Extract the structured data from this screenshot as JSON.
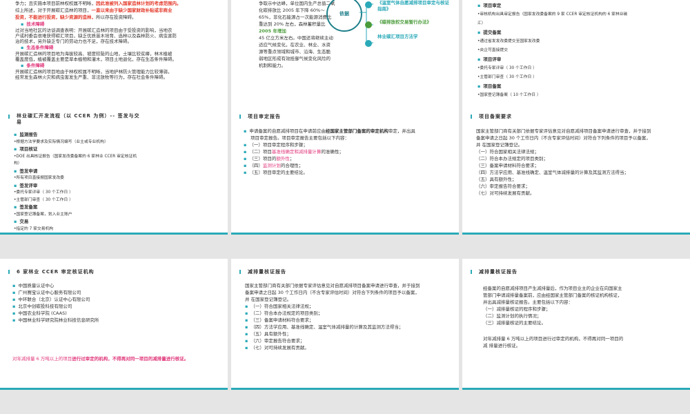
{
  "s1": {
    "lines": [
      "争力；且实施本项目前林权权属不明晰，",
      "因此准被列入国家造林计划的考虑范围内。",
      "综上所述，对于开展碳汇造林的项目，",
      "一直以来由于缺少国家财政补贴或非商业",
      "投资，不能进行投资，",
      "缺少资源的造林，",
      "所以存在投资障碍。",
      "技术障碍",
      "过对当地社区的访谈调查表明：开展碳汇造林的项目由于受投资的影响，当地农",
      "户或村委会很难获得碳汇项目，缺乏优质苗木培育、选林以及森林防火、病虫害防",
      "治的技术，另外缺乏专门的劳动力也不足，存在技术障碍。",
      "生态条件障碍",
      "开展碳汇造林的项目地为海拔较高、坡度较陡的山地，土壤比较贫瘠，林木植被",
      "覆盖度低，植被覆盖主要是草本植物和灌木，项目土地退化，存在生态条件障碍。",
      "条件障碍",
      "开展碳汇造林的项目地由于林权权属不明晰，当地护林防火管理能力比较薄弱，",
      "经常发生森林火灾和病虫害发生严重、非法放牧等行为，存在社会条件障碍。"
    ]
  },
  "s2": {
    "left": [
      "争取示中达峰，单位国内生产总值二氧",
      "化碳排放比 2005 年下降 60%～",
      "65%，非化石能源占一次能源消费比",
      "重达到 20% 左右，森林蓄积量比",
      "2005 年增加",
      "45 亿立方米左右。中国还将继续主动",
      "适应气候变化，在农业、林业、水资",
      "源等重点领域和城市、沿海、生态脆",
      "弱地区形成有效抵御气候变化风险的",
      "机制和能力。"
    ],
    "hub": "依据",
    "items": [
      "《温室气体自愿减排项目审定与核证指南》",
      "《碳排放权交易暂行办法》",
      "林业碳汇项目方法学"
    ]
  },
  "s3": {
    "items": [
      {
        "type": "sec",
        "text": "项目审定"
      },
      {
        "type": "txt",
        "text": "•审核机构出具审定报告（国家发改委备案的 9 家 CCER 审定核证机构的 6 家林业碳"
      },
      {
        "type": "txt",
        "text": "汇）"
      },
      {
        "type": "sec",
        "text": "提交备案"
      },
      {
        "type": "txt",
        "text": "•通过省发发改委提交至国家发改委"
      },
      {
        "type": "txt",
        "text": "•央企可直接提交"
      },
      {
        "type": "sec",
        "text": "项目评审"
      },
      {
        "type": "txt",
        "text": "•委托专家评审（ 30 个工作日 ）"
      },
      {
        "type": "txt",
        "text": "•主管部门审查（ 30 个工作日 ）"
      },
      {
        "type": "sec",
        "text": "项目备案"
      },
      {
        "type": "txt",
        "text": "•国家登记簿备案（ 10 个工作日 ）"
      }
    ]
  },
  "s4": {
    "title": "林业碳汇开发流程（以 CCER 为例）-- 签发与交易",
    "items": [
      {
        "type": "sec",
        "text": "监测报告"
      },
      {
        "type": "txt",
        "text": "•根据方法学要求及实际情况编写（业主或专业机构）"
      },
      {
        "type": "sec",
        "text": "项目核证"
      },
      {
        "type": "txt",
        "text": "•DOE 出具核证报告（国家发改委备案的 6 家林业 CCER 审定核证机"
      },
      {
        "type": "txt",
        "text": "构）"
      },
      {
        "type": "sec",
        "text": "签发申请"
      },
      {
        "type": "txt",
        "text": "•所有项目直接报国家发改委"
      },
      {
        "type": "sec",
        "text": "签发评审"
      },
      {
        "type": "txt",
        "text": "•委托专家评审（ 30 个工作日 ）"
      },
      {
        "type": "txt",
        "text": "•主管部门审查（ 30 个工作日 ）"
      },
      {
        "type": "sec",
        "text": "签发备案"
      },
      {
        "type": "txt",
        "text": "•国家登记簿备案，划入业主账户"
      },
      {
        "type": "sec",
        "text": "交易"
      },
      {
        "type": "txt",
        "text": "•指定的 7 家交易机构"
      }
    ]
  },
  "s5": {
    "title": "项目审定报告",
    "intro": [
      "申请备案的自愿减排项目在申请前应由",
      "经国家主管部门备案的审定机构",
      "审定，并出具",
      "项目审定报告。项目审定报告主要包括以下内容："
    ],
    "items": [
      {
        "a": "（一）项目审定程序和步骤；",
        "b": ""
      },
      {
        "a": "（二）项目",
        "b": "基准线确定和减排量计算",
        "c": "的准确性；"
      },
      {
        "a": "（三）项目的",
        "b": "额外性",
        "c": "；"
      },
      {
        "a": "（四）",
        "b": "监测计划",
        "c": "的合理性；"
      },
      {
        "a": "（五）项目审定的主要结论。",
        "b": ""
      }
    ]
  },
  "s6": {
    "title": "项目备案要求",
    "intro": [
      "国家主管部门商有关部门依据专家评估意见对自愿减排项目备案申请进行审查，并于接到",
      "备案申请之日起 30 个工作日内（不含专家评估时间）对符合下列条件的项目予以备案，",
      "并 在国家登记簿登记。"
    ],
    "items": [
      "（一）符合国家相关法律法规；",
      "（二）符合本办法规定的项目类别；",
      "（三）备案申请材料符合要求；",
      "（四）方法学应用、基准线确定、温室气体减排量的计算及其监测方法得当；",
      "（五）具有额外性；",
      "（六）审定报告符合要求；",
      "（七）对可持续发展有贡献。"
    ]
  },
  "s7": {
    "title": "6 家林业 CCER 审定核证机构",
    "items": [
      "中国质量认证中心",
      "广州赛宝认证中心服务有限公司",
      "中环联合（北京）认证中心有限公司",
      "北京中创碳投科技有限公司",
      "中国农业科学院 (CAAS)",
      "中国林业科学研究院林业科技信息研究所"
    ],
    "note": [
      "对年减排量 6 万吨以上的项目",
      "进行过审定的机构，不得再对同一项目的减排量进行核证。"
    ]
  },
  "s8": {
    "title": "减排量核证报告",
    "intro": [
      "国家主管部门商有关部门依据专家评估意见对自愿减排项目备案申请进行审查，并于接到",
      "备案申请之日起 30 个工作日内（不含专家评估时间）对符合下列条件的项目予以备案，",
      "并 在国家登记簿登记。"
    ],
    "items": [
      "（一）符合国家相关法律法规；",
      "（二）符合本办法规定的项目类别；",
      "（三）备案申请材料符合要求；",
      "（四）方法学应用、基准线确定、温室气体减排量的计算及其监测方法得当；",
      "（五）具有额外性；",
      "（六）审定报告符合要求；",
      "（七）对可持续发展有贡献。"
    ]
  },
  "s9": {
    "title": "减排量核证报告",
    "lines": [
      "经备案的自愿减排项目产生减排量后，作为项目业主的企业在向国家主",
      "管部门申请减排量备案前，应由经国家主管部门备案的核证机构核证，",
      "并出具减排量核证报告。主要包括以下内容：",
      "（一）减排量核证的程序和步骤；",
      "（二）监测计划的执行情况；",
      "（三）减排量核证的主要结论。",
      "",
      "对年减排量 6 万吨以上的项目进行过审定的机构，不得再对同一项目的",
      "减 排量进行核证。"
    ]
  },
  "colors": {
    "accent": "#2aa9b8",
    "red": "#e43b2c",
    "pink": "#e0367a",
    "green": "#4a9b3a"
  }
}
